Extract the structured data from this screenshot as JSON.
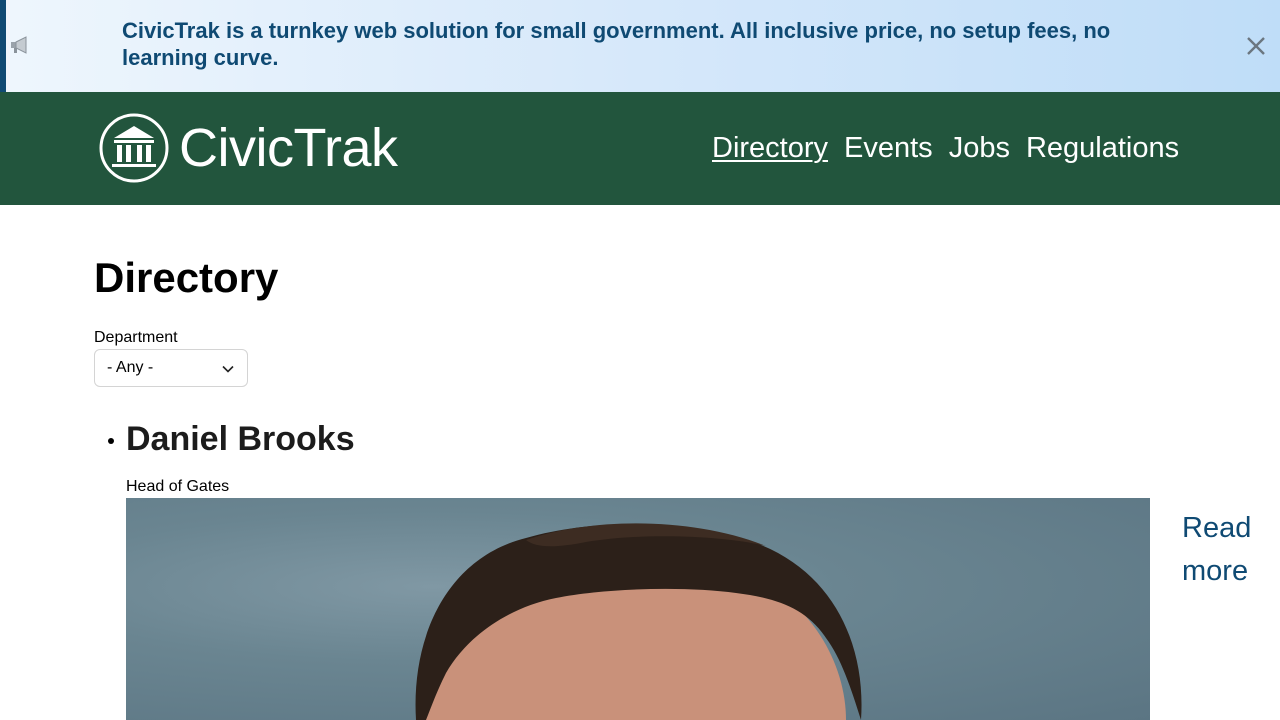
{
  "banner": {
    "message": "CivicTrak is a turnkey web solution for small government. All inclusive price, no setup fees, no learning curve.",
    "icon": "megaphone-icon",
    "close_icon": "close-icon",
    "accent_color": "#0f4a73"
  },
  "header": {
    "site_name": "CivicTrak",
    "logo_icon": "government-building-icon",
    "background_color": "#22553d",
    "nav": [
      {
        "label": "Directory",
        "active": true
      },
      {
        "label": "Events",
        "active": false
      },
      {
        "label": "Jobs",
        "active": false
      },
      {
        "label": "Regulations",
        "active": false
      }
    ]
  },
  "main": {
    "title": "Directory",
    "filter": {
      "label": "Department",
      "selected": "- Any -"
    },
    "people": [
      {
        "name": "Daniel Brooks",
        "role": "Head of Gates",
        "read_more": "Read more"
      }
    ]
  }
}
